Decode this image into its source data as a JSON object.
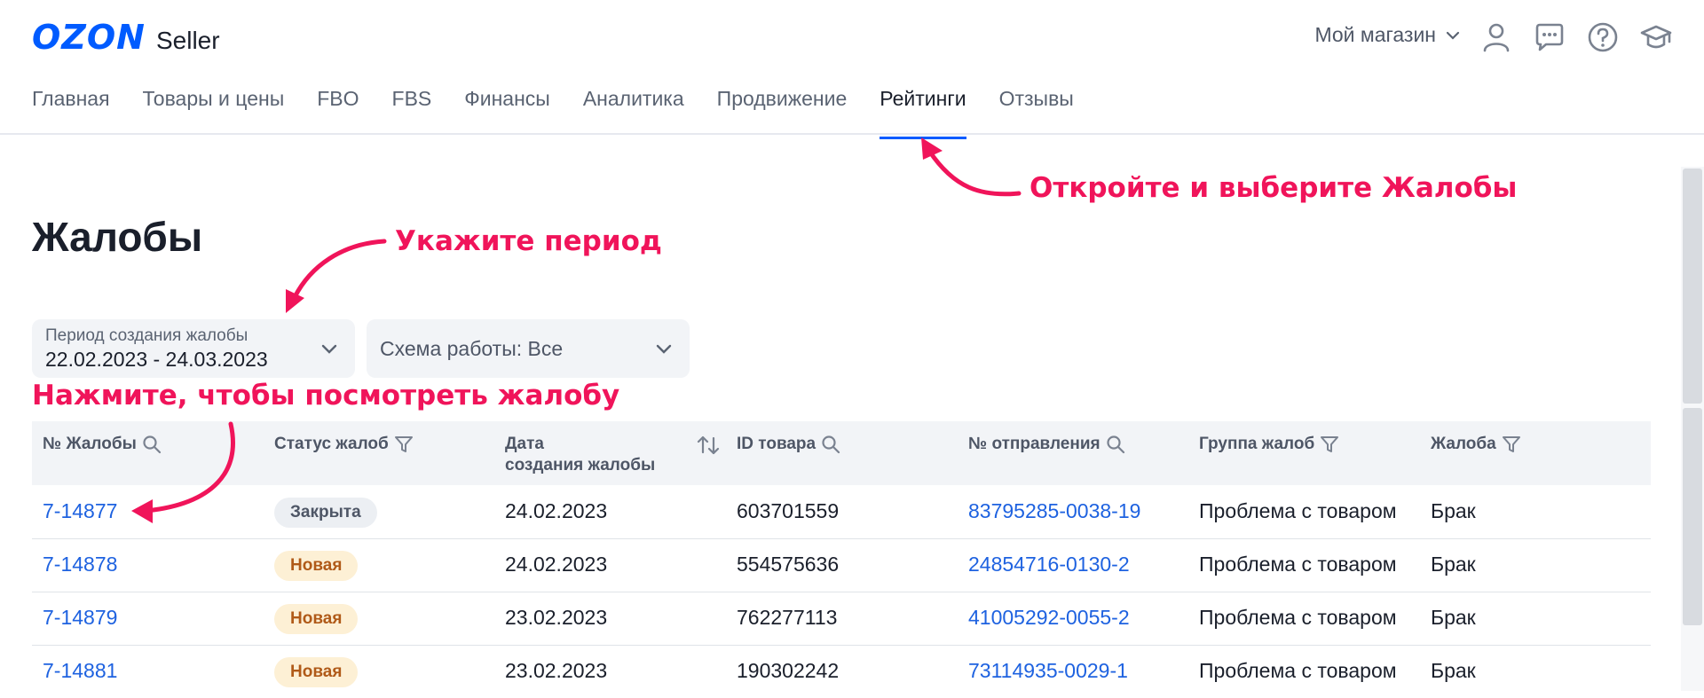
{
  "header": {
    "logo_brand": "OZON",
    "logo_product": "Seller",
    "store_selector": "Мой магазин",
    "icons": [
      "chevron-down-icon",
      "user-icon",
      "chat-icon",
      "help-icon",
      "education-icon"
    ]
  },
  "nav": {
    "items": [
      "Главная",
      "Товары и цены",
      "FBO",
      "FBS",
      "Финансы",
      "Аналитика",
      "Продвижение",
      "Рейтинги",
      "Отзывы"
    ],
    "active": "Рейтинги"
  },
  "page": {
    "title": "Жалобы"
  },
  "filters": {
    "period": {
      "label": "Период создания жалобы",
      "value": "22.02.2023 - 24.03.2023"
    },
    "scheme": {
      "value": "Схема работы: Все"
    }
  },
  "table": {
    "headers": {
      "complaint_no": "№ Жалобы",
      "status": "Статус жалоб",
      "date_line1": "Дата",
      "date_line2": "создания жалобы",
      "product_id": "ID товара",
      "shipment_no": "№ отправления",
      "group": "Группа жалоб",
      "complaint": "Жалоба"
    },
    "rows": [
      {
        "no": "7-14877",
        "status": "Закрыта",
        "status_type": "closed",
        "date": "24.02.2023",
        "product_id": "603701559",
        "shipment": "83795285-0038-19",
        "group": "Проблема с товаром",
        "complaint": "Брак"
      },
      {
        "no": "7-14878",
        "status": "Новая",
        "status_type": "new",
        "date": "24.02.2023",
        "product_id": "554575636",
        "shipment": "24854716-0130-2",
        "group": "Проблема с товаром",
        "complaint": "Брак"
      },
      {
        "no": "7-14879",
        "status": "Новая",
        "status_type": "new",
        "date": "23.02.2023",
        "product_id": "762277113",
        "shipment": "41005292-0055-2",
        "group": "Проблема с товаром",
        "complaint": "Брак"
      },
      {
        "no": "7-14881",
        "status": "Новая",
        "status_type": "new",
        "date": "23.02.2023",
        "product_id": "190302242",
        "shipment": "73114935-0029-1",
        "group": "Проблема с товаром",
        "complaint": "Брак"
      }
    ]
  },
  "annotations": {
    "open_select": "Откройте и выберите Жалобы",
    "set_period": "Укажите период",
    "click_view": "Нажмите, чтобы посмотреть жалобу"
  },
  "colors": {
    "brand": "#005bff",
    "link": "#1e62e0",
    "annotation": "#f0145a",
    "badge_new_bg": "#fdf0d5",
    "badge_new_text": "#b05a18"
  }
}
